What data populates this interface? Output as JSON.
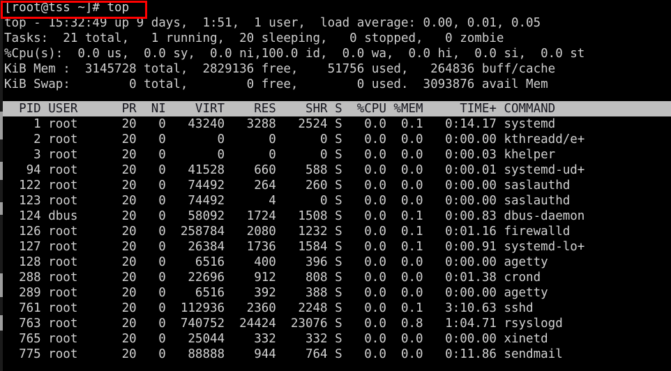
{
  "terminal": {
    "prompt_line": "[root@tss ~]# top",
    "annotation_color": "#ff0000",
    "background_color": "#000000",
    "foreground_color": "#cfcfcf",
    "header_row_background": "#bfbfbf",
    "header_row_foreground": "#16161e"
  },
  "summary": {
    "uptime_line": "top - 15:32:49 up 9 days,  1:51,  1 user,  load average: 0.00, 0.01, 0.05",
    "tasks_line": "Tasks:  21 total,   1 running,  20 sleeping,   0 stopped,   0 zombie",
    "cpu_line": "%Cpu(s):  0.0 us,  0.0 sy,  0.0 ni,100.0 id,  0.0 wa,  0.0 hi,  0.0 si,  0.0 st",
    "mem_line": "KiB Mem :  3145728 total,  2829136 free,    51756 used,   264836 buff/cache",
    "swap_line": "KiB Swap:        0 total,        0 free,        0 used.  3093876 avail Mem",
    "fields": {
      "time": "15:32:49",
      "up_days": 9,
      "up_hhmm": "1:51",
      "users": 1,
      "load_avg_1": "0.00",
      "load_avg_5": "0.01",
      "load_avg_15": "0.05",
      "tasks_total": 21,
      "tasks_running": 1,
      "tasks_sleeping": 20,
      "tasks_stopped": 0,
      "tasks_zombie": 0,
      "cpu_us": "0.0",
      "cpu_sy": "0.0",
      "cpu_ni": "0.0",
      "cpu_id": "100.0",
      "cpu_wa": "0.0",
      "cpu_hi": "0.0",
      "cpu_si": "0.0",
      "cpu_st": "0.0",
      "mem_total": 3145728,
      "mem_free": 2829136,
      "mem_used": 51756,
      "mem_buff_cache": 264836,
      "swap_total": 0,
      "swap_free": 0,
      "swap_used": 0,
      "avail_mem": 3093876
    }
  },
  "table": {
    "header_line": "  PID USER      PR  NI    VIRT    RES    SHR S  %CPU %MEM     TIME+ COMMAND",
    "columns": [
      "PID",
      "USER",
      "PR",
      "NI",
      "VIRT",
      "RES",
      "SHR",
      "S",
      "%CPU",
      "%MEM",
      "TIME+",
      "COMMAND"
    ],
    "rows": [
      "    1 root      20   0   43240   3288   2524 S   0.0  0.1   0:14.17 systemd",
      "    2 root      20   0       0      0      0 S   0.0  0.0   0:00.00 kthreadd/e+",
      "    3 root      20   0       0      0      0 S   0.0  0.0   0:00.03 khelper",
      "   94 root      20   0   41528    660    588 S   0.0  0.0   0:00.01 systemd-ud+",
      "  122 root      20   0   74492    264    260 S   0.0  0.0   0:00.00 saslauthd",
      "  123 root      20   0   74492      4      0 S   0.0  0.0   0:00.00 saslauthd",
      "  124 dbus      20   0   58092   1724   1508 S   0.0  0.1   0:00.83 dbus-daemon",
      "  126 root      20   0  258784   2080   1232 S   0.0  0.1   0:01.16 firewalld",
      "  127 root      20   0   26384   1736   1584 S   0.0  0.1   0:00.91 systemd-lo+",
      "  128 root      20   0    6516    400    396 S   0.0  0.0   0:00.00 agetty",
      "  288 root      20   0   22696    912    808 S   0.0  0.0   0:01.38 crond",
      "  289 root      20   0    6516    392    388 S   0.0  0.0   0:00.00 agetty",
      "  761 root      20   0  112936   2360   2248 S   0.0  0.1   3:10.63 sshd",
      "  763 root      20   0  740752  24424  23076 S   0.0  0.8   1:04.71 rsyslogd",
      "  765 root      20   0   25044    332    332 S   0.0  0.0   0:00.00 xinetd",
      "  775 root      20   0   88888    944    764 S   0.0  0.0   0:11.86 sendmail"
    ],
    "row_values": [
      {
        "pid": 1,
        "user": "root",
        "pr": 20,
        "ni": 0,
        "virt": 43240,
        "res": 3288,
        "shr": 2524,
        "s": "S",
        "cpu": "0.0",
        "mem": "0.1",
        "time": "0:14.17",
        "command": "systemd"
      },
      {
        "pid": 2,
        "user": "root",
        "pr": 20,
        "ni": 0,
        "virt": 0,
        "res": 0,
        "shr": 0,
        "s": "S",
        "cpu": "0.0",
        "mem": "0.0",
        "time": "0:00.00",
        "command": "kthreadd/e+"
      },
      {
        "pid": 3,
        "user": "root",
        "pr": 20,
        "ni": 0,
        "virt": 0,
        "res": 0,
        "shr": 0,
        "s": "S",
        "cpu": "0.0",
        "mem": "0.0",
        "time": "0:00.03",
        "command": "khelper"
      },
      {
        "pid": 94,
        "user": "root",
        "pr": 20,
        "ni": 0,
        "virt": 41528,
        "res": 660,
        "shr": 588,
        "s": "S",
        "cpu": "0.0",
        "mem": "0.0",
        "time": "0:00.01",
        "command": "systemd-ud+"
      },
      {
        "pid": 122,
        "user": "root",
        "pr": 20,
        "ni": 0,
        "virt": 74492,
        "res": 264,
        "shr": 260,
        "s": "S",
        "cpu": "0.0",
        "mem": "0.0",
        "time": "0:00.00",
        "command": "saslauthd"
      },
      {
        "pid": 123,
        "user": "root",
        "pr": 20,
        "ni": 0,
        "virt": 74492,
        "res": 4,
        "shr": 0,
        "s": "S",
        "cpu": "0.0",
        "mem": "0.0",
        "time": "0:00.00",
        "command": "saslauthd"
      },
      {
        "pid": 124,
        "user": "dbus",
        "pr": 20,
        "ni": 0,
        "virt": 58092,
        "res": 1724,
        "shr": 1508,
        "s": "S",
        "cpu": "0.0",
        "mem": "0.1",
        "time": "0:00.83",
        "command": "dbus-daemon"
      },
      {
        "pid": 126,
        "user": "root",
        "pr": 20,
        "ni": 0,
        "virt": 258784,
        "res": 2080,
        "shr": 1232,
        "s": "S",
        "cpu": "0.0",
        "mem": "0.1",
        "time": "0:01.16",
        "command": "firewalld"
      },
      {
        "pid": 127,
        "user": "root",
        "pr": 20,
        "ni": 0,
        "virt": 26384,
        "res": 1736,
        "shr": 1584,
        "s": "S",
        "cpu": "0.0",
        "mem": "0.1",
        "time": "0:00.91",
        "command": "systemd-lo+"
      },
      {
        "pid": 128,
        "user": "root",
        "pr": 20,
        "ni": 0,
        "virt": 6516,
        "res": 400,
        "shr": 396,
        "s": "S",
        "cpu": "0.0",
        "mem": "0.0",
        "time": "0:00.00",
        "command": "agetty"
      },
      {
        "pid": 288,
        "user": "root",
        "pr": 20,
        "ni": 0,
        "virt": 22696,
        "res": 912,
        "shr": 808,
        "s": "S",
        "cpu": "0.0",
        "mem": "0.0",
        "time": "0:01.38",
        "command": "crond"
      },
      {
        "pid": 289,
        "user": "root",
        "pr": 20,
        "ni": 0,
        "virt": 6516,
        "res": 392,
        "shr": 388,
        "s": "S",
        "cpu": "0.0",
        "mem": "0.0",
        "time": "0:00.00",
        "command": "agetty"
      },
      {
        "pid": 761,
        "user": "root",
        "pr": 20,
        "ni": 0,
        "virt": 112936,
        "res": 2360,
        "shr": 2248,
        "s": "S",
        "cpu": "0.0",
        "mem": "0.1",
        "time": "3:10.63",
        "command": "sshd"
      },
      {
        "pid": 763,
        "user": "root",
        "pr": 20,
        "ni": 0,
        "virt": 740752,
        "res": 24424,
        "shr": 23076,
        "s": "S",
        "cpu": "0.0",
        "mem": "0.8",
        "time": "1:04.71",
        "command": "rsyslogd"
      },
      {
        "pid": 765,
        "user": "root",
        "pr": 20,
        "ni": 0,
        "virt": 25044,
        "res": 332,
        "shr": 332,
        "s": "S",
        "cpu": "0.0",
        "mem": "0.0",
        "time": "0:00.00",
        "command": "xinetd"
      },
      {
        "pid": 775,
        "user": "root",
        "pr": 20,
        "ni": 0,
        "virt": 88888,
        "res": 944,
        "shr": 764,
        "s": "S",
        "cpu": "0.0",
        "mem": "0.0",
        "time": "0:11.86",
        "command": "sendmail"
      }
    ]
  }
}
